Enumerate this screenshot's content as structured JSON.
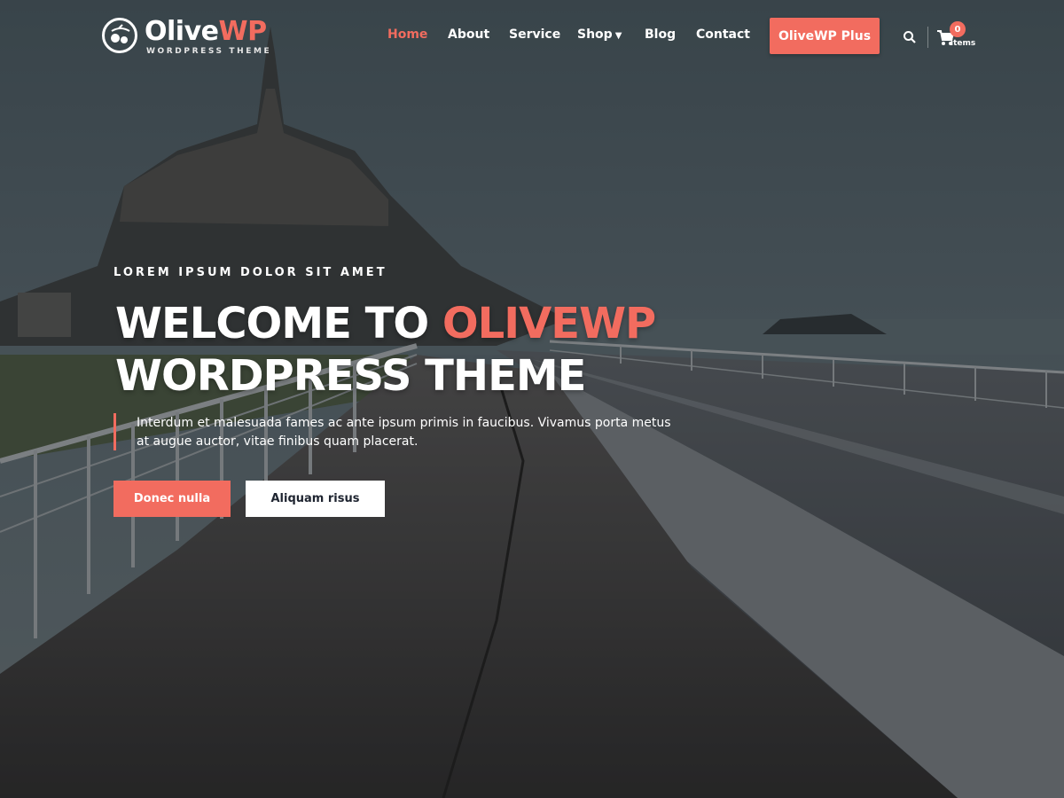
{
  "colors": {
    "accent": "#f26c5f",
    "text": "#ffffff"
  },
  "logo": {
    "name_main": "Olive",
    "name_accent": "WP",
    "tagline": "WORDPRESS THEME"
  },
  "nav": {
    "items": [
      {
        "label": "Home",
        "active": true
      },
      {
        "label": "About"
      },
      {
        "label": "Service"
      },
      {
        "label": "Shop",
        "has_dropdown": true
      },
      {
        "label": "Blog"
      },
      {
        "label": "Contact"
      }
    ],
    "cta_label": "OliveWP Plus"
  },
  "cart": {
    "count": "0",
    "label": "items"
  },
  "hero": {
    "eyebrow": "LOREM IPSUM DOLOR SIT AMET",
    "headline_line1_plain": "WELCOME TO ",
    "headline_line1_accent": "OLIVEWP",
    "headline_line2": "WORDPRESS THEME",
    "description": "Interdum et malesuada fames ac ante ipsum primis in faucibus. Vivamus porta metus at augue auctor, vitae finibus quam placerat.",
    "primary_button": "Donec nulla",
    "secondary_button": "Aliquam risus"
  }
}
